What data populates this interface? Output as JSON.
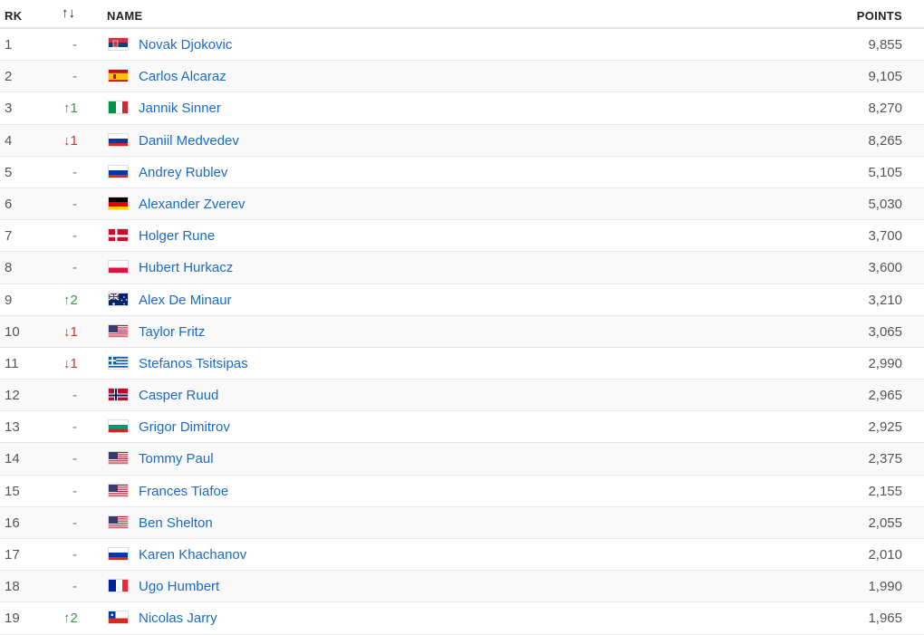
{
  "header": {
    "rank": "RK",
    "movement": "↑↓",
    "name": "NAME",
    "points": "POINTS"
  },
  "players": [
    {
      "rank": "1",
      "move": "-",
      "dir": "none",
      "flag": "serbia",
      "name": "Novak Djokovic",
      "points": "9,855"
    },
    {
      "rank": "2",
      "move": "-",
      "dir": "none",
      "flag": "spain",
      "name": "Carlos Alcaraz",
      "points": "9,105"
    },
    {
      "rank": "3",
      "move": "1",
      "dir": "up",
      "flag": "italy",
      "name": "Jannik Sinner",
      "points": "8,270"
    },
    {
      "rank": "4",
      "move": "1",
      "dir": "down",
      "flag": "russia",
      "name": "Daniil Medvedev",
      "points": "8,265"
    },
    {
      "rank": "5",
      "move": "-",
      "dir": "none",
      "flag": "russia",
      "name": "Andrey Rublev",
      "points": "5,105"
    },
    {
      "rank": "6",
      "move": "-",
      "dir": "none",
      "flag": "germany",
      "name": "Alexander Zverev",
      "points": "5,030"
    },
    {
      "rank": "7",
      "move": "-",
      "dir": "none",
      "flag": "denmark",
      "name": "Holger Rune",
      "points": "3,700"
    },
    {
      "rank": "8",
      "move": "-",
      "dir": "none",
      "flag": "poland",
      "name": "Hubert Hurkacz",
      "points": "3,600"
    },
    {
      "rank": "9",
      "move": "2",
      "dir": "up",
      "flag": "australia",
      "name": "Alex De Minaur",
      "points": "3,210"
    },
    {
      "rank": "10",
      "move": "1",
      "dir": "down",
      "flag": "usa",
      "name": "Taylor Fritz",
      "points": "3,065"
    },
    {
      "rank": "11",
      "move": "1",
      "dir": "down",
      "flag": "greece",
      "name": "Stefanos Tsitsipas",
      "points": "2,990"
    },
    {
      "rank": "12",
      "move": "-",
      "dir": "none",
      "flag": "norway",
      "name": "Casper Ruud",
      "points": "2,965"
    },
    {
      "rank": "13",
      "move": "-",
      "dir": "none",
      "flag": "bulgaria",
      "name": "Grigor Dimitrov",
      "points": "2,925"
    },
    {
      "rank": "14",
      "move": "-",
      "dir": "none",
      "flag": "usa",
      "name": "Tommy Paul",
      "points": "2,375"
    },
    {
      "rank": "15",
      "move": "-",
      "dir": "none",
      "flag": "usa",
      "name": "Frances Tiafoe",
      "points": "2,155"
    },
    {
      "rank": "16",
      "move": "-",
      "dir": "none",
      "flag": "usa",
      "name": "Ben Shelton",
      "points": "2,055"
    },
    {
      "rank": "17",
      "move": "-",
      "dir": "none",
      "flag": "russia",
      "name": "Karen Khachanov",
      "points": "2,010"
    },
    {
      "rank": "18",
      "move": "-",
      "dir": "none",
      "flag": "france",
      "name": "Ugo Humbert",
      "points": "1,990"
    },
    {
      "rank": "19",
      "move": "2",
      "dir": "up",
      "flag": "chile",
      "name": "Nicolas Jarry",
      "points": "1,965"
    }
  ],
  "colors": {
    "link": "#1a6bc4",
    "up": "#2e9e3d",
    "down": "#d0312d"
  }
}
